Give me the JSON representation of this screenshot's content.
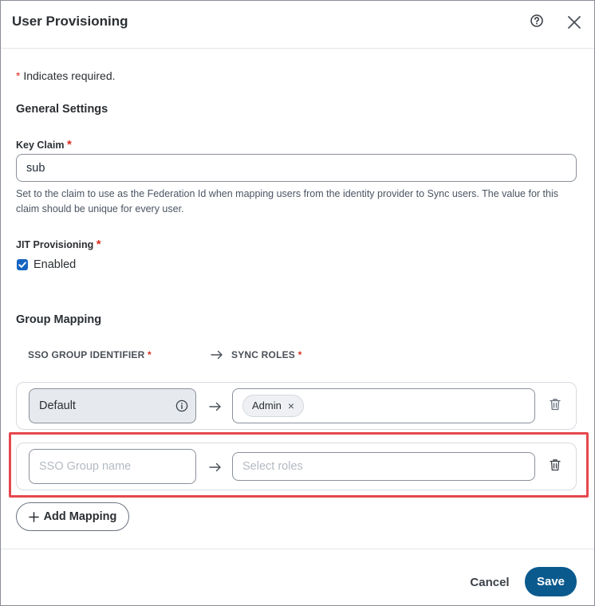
{
  "dialog": {
    "title": "User Provisioning",
    "help_icon": "help-circle-icon",
    "close_icon": "close-icon"
  },
  "required_note": {
    "star": "*",
    "text": "Indicates required."
  },
  "general_settings": {
    "title": "General Settings",
    "key_claim": {
      "label": "Key Claim",
      "star": "*",
      "value": "sub",
      "helper": "Set to the claim to use as the Federation Id when mapping users from the identity provider to Sync users. The value for this claim should be unique for every user."
    },
    "jit": {
      "label": "JIT Provisioning",
      "star": "*",
      "checkbox_label": "Enabled",
      "checked": true
    }
  },
  "group_mapping": {
    "title": "Group Mapping",
    "columns": {
      "sso_group": "SSO GROUP IDENTIFIER",
      "sync_roles": "SYNC ROLES",
      "star": "*"
    },
    "rows": [
      {
        "group": "Default",
        "roles": [
          "Admin"
        ]
      },
      {
        "group_placeholder": "SSO Group name",
        "roles_placeholder": "Select roles"
      }
    ],
    "add_label": "Add Mapping"
  },
  "footer": {
    "cancel": "Cancel",
    "save": "Save"
  },
  "colors": {
    "primary": "#0b5a8e",
    "required": "#d92d20",
    "checkbox": "#1565c0",
    "highlight": "#e5484d"
  }
}
